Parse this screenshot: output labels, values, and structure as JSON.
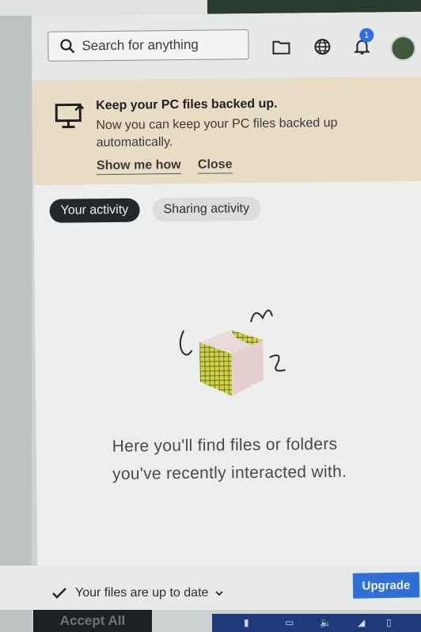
{
  "search": {
    "placeholder": "Search for anything"
  },
  "notifications": {
    "count": "1"
  },
  "banner": {
    "title": "Keep your PC files backed up.",
    "description": "Now you can keep your PC files backed up automatically.",
    "show_me_how": "Show me how",
    "close": "Close"
  },
  "tabs": [
    {
      "label": "Your activity",
      "active": true
    },
    {
      "label": "Sharing activity",
      "active": false
    }
  ],
  "empty_state": {
    "message": "Here you'll find files or folders you've recently interacted with."
  },
  "footer": {
    "status": "Your files are up to date",
    "upgrade": "Upgrade",
    "accept": "Accept All"
  },
  "colors": {
    "accent": "#2f6fd6",
    "banner_bg": "#e8dcc5",
    "active_tab": "#24282c"
  },
  "icons": [
    "search-icon",
    "folder-icon",
    "globe-icon",
    "bell-icon",
    "monitor-upload-icon",
    "check-icon",
    "chevron-down-icon"
  ]
}
